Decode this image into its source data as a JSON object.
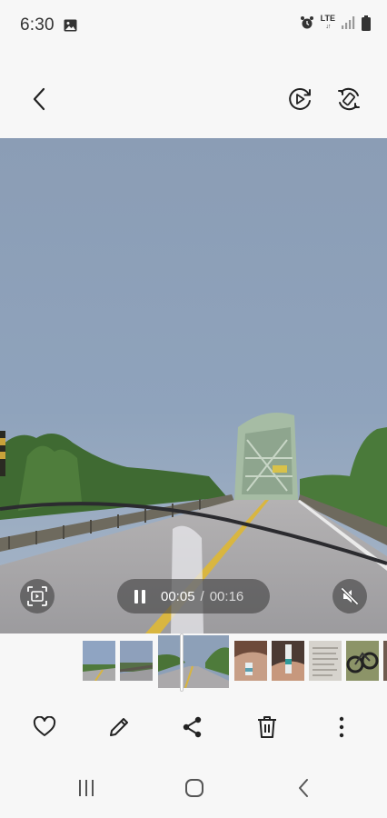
{
  "status_bar": {
    "time": "6:30",
    "network": "LTE",
    "icons": [
      "gallery-notification-icon",
      "alarm-icon",
      "lte-data-icon",
      "signal-icon",
      "battery-icon"
    ]
  },
  "top_bar": {
    "icons": [
      "back-arrow-icon",
      "motion-photo-icon",
      "rotate-icon"
    ]
  },
  "player": {
    "current_time": "00:05",
    "separator": "/",
    "total_time": "00:16",
    "state": "playing",
    "muted": true,
    "icons": [
      "capture-frame-icon",
      "pause-icon",
      "mute-icon"
    ]
  },
  "filmstrip": {
    "thumbnails": [
      "road-bridge-1",
      "road-bridge-2",
      "road-bridge-current",
      "hand-sample",
      "hand-vial",
      "document",
      "bicycles",
      "partial"
    ]
  },
  "actions": {
    "icons": [
      "heart-icon",
      "edit-pencil-icon",
      "share-icon",
      "trash-icon",
      "more-options-icon"
    ]
  },
  "nav_bar": {
    "icons": [
      "recent-apps-icon",
      "home-icon",
      "back-icon"
    ]
  },
  "colors": {
    "background": "#f7f7f7",
    "icon": "#222222",
    "overlay": "#464646",
    "sky": "#8d9fb7",
    "bridge": "#9bb49b",
    "road": "#a7a6a8"
  }
}
